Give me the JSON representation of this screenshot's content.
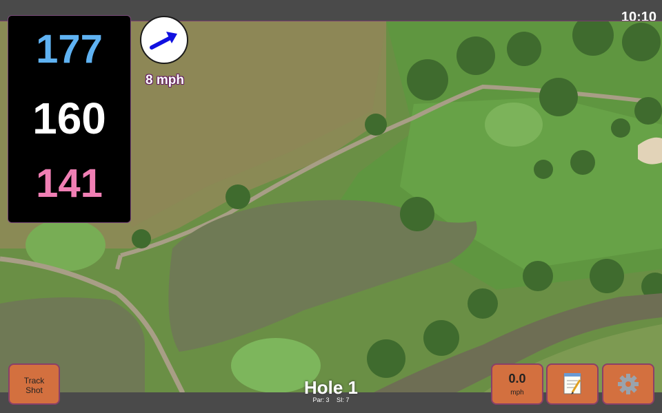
{
  "status": {
    "time": "10:10"
  },
  "distances": {
    "back": "177",
    "middle": "160",
    "front": "141"
  },
  "wind": {
    "speed": "8 mph",
    "icon": "wind-arrow-icon"
  },
  "buttons": {
    "track_line1": "Track",
    "track_line2": "Shot",
    "speed_value": "0.0",
    "speed_unit": "mph",
    "notes_icon": "notepad-icon",
    "settings_icon": "gear-icon"
  },
  "hole": {
    "title": "Hole 1",
    "par": "Par: 3",
    "si": "SI: 7"
  },
  "colors": {
    "back": "#5fb2f2",
    "middle": "#ffffff",
    "front": "#f07fb4",
    "button": "#d3703f",
    "bar": "#4a4a4a",
    "wind_arrow": "#1010e0"
  }
}
